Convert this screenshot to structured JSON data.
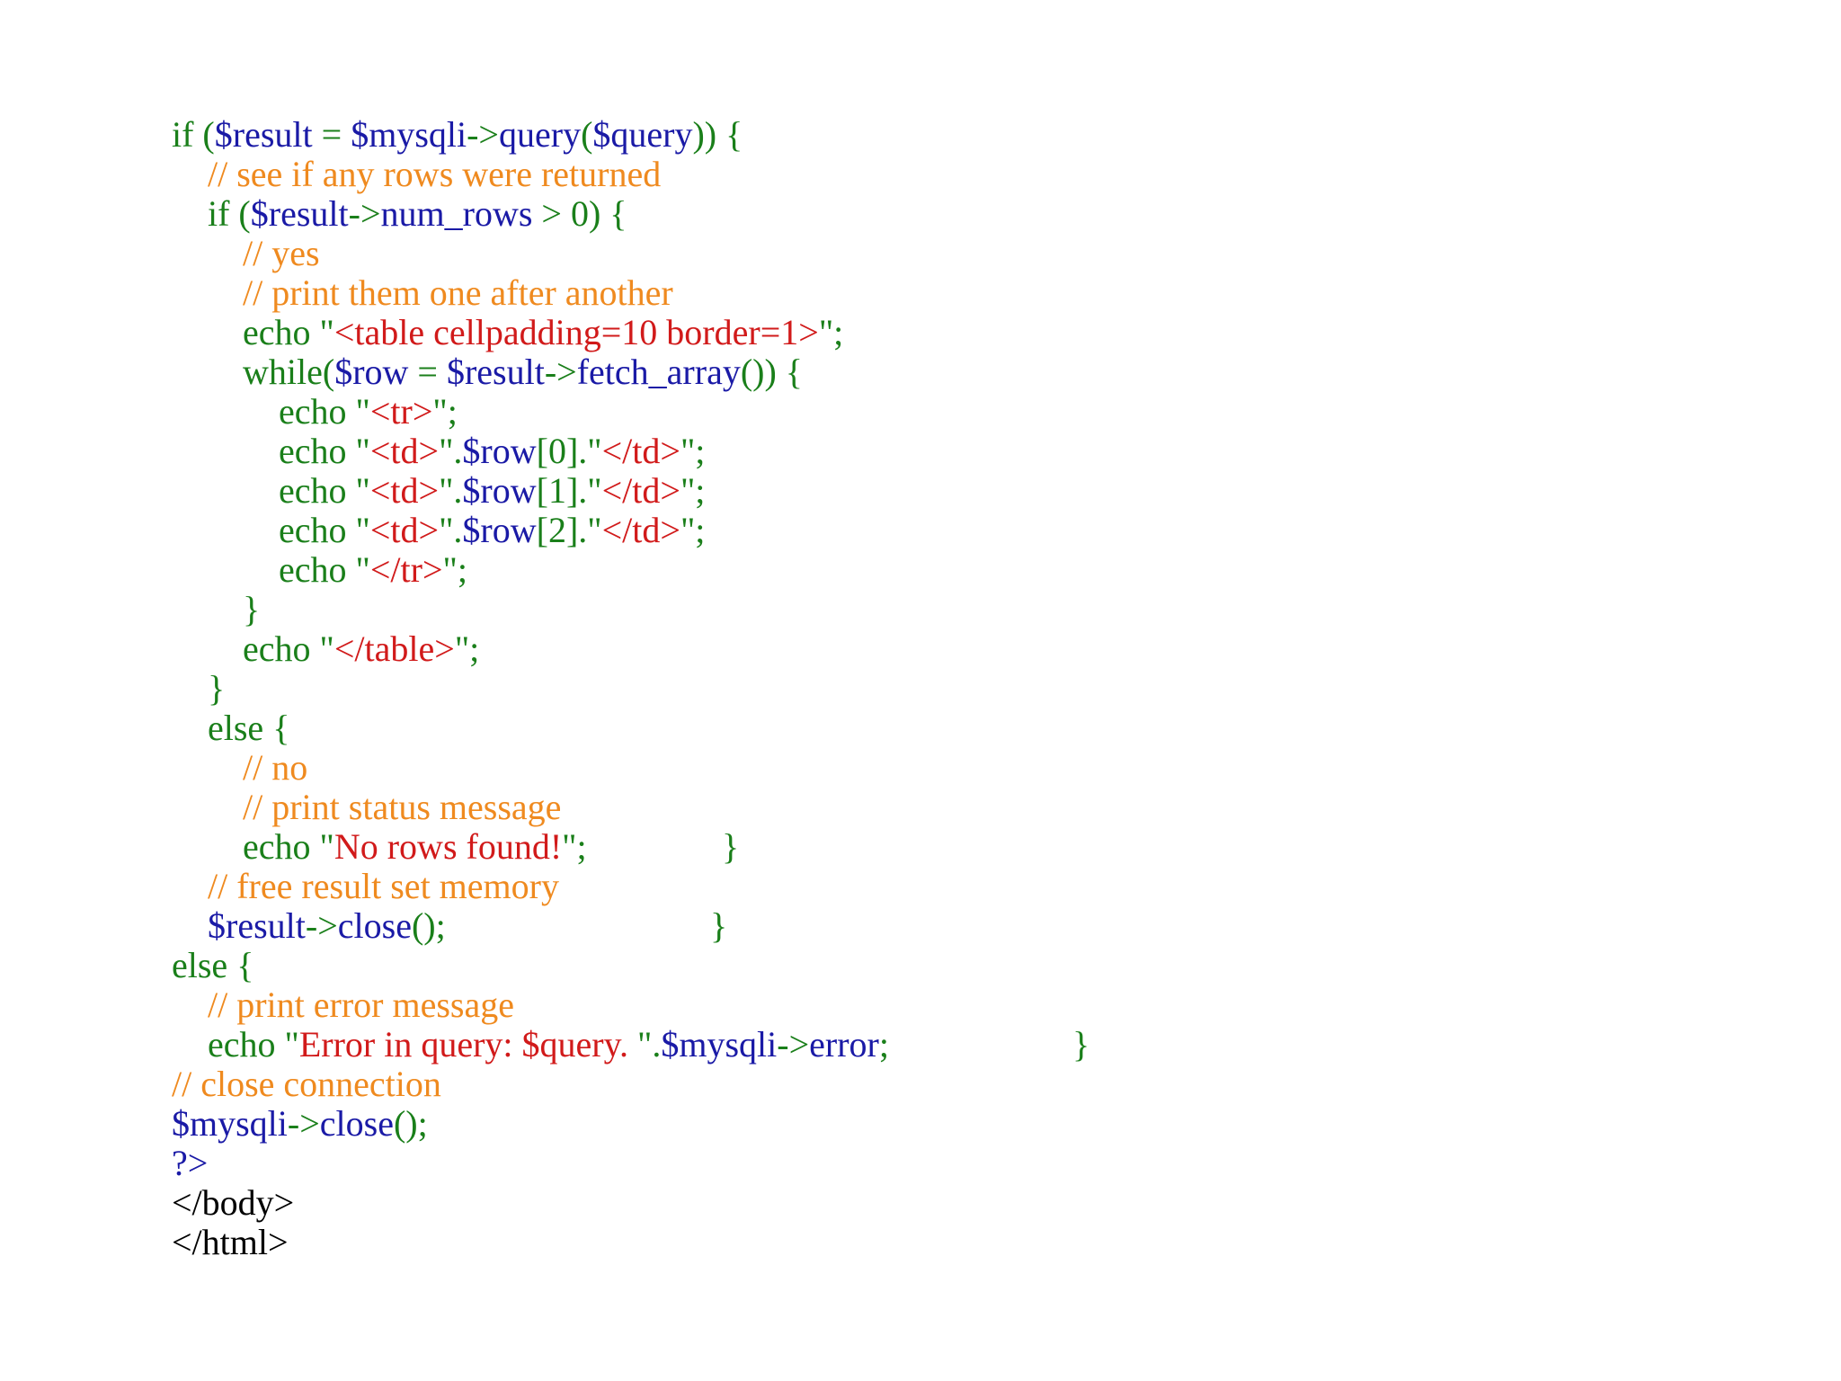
{
  "colors": {
    "keyword": "#1a7f1a",
    "variable": "#1a1aa6",
    "string": "#d11a1a",
    "comment": "#ef8a1f",
    "plain": "#000000"
  },
  "lines": [
    {
      "indent": 0,
      "tokens": [
        {
          "t": "if (",
          "c": "keyword"
        },
        {
          "t": "$result",
          "c": "variable"
        },
        {
          "t": " = ",
          "c": "keyword"
        },
        {
          "t": "$mysqli",
          "c": "variable"
        },
        {
          "t": "->",
          "c": "keyword"
        },
        {
          "t": "query",
          "c": "variable"
        },
        {
          "t": "(",
          "c": "keyword"
        },
        {
          "t": "$query",
          "c": "variable"
        },
        {
          "t": ")) {",
          "c": "keyword"
        }
      ]
    },
    {
      "indent": 1,
      "tokens": [
        {
          "t": "// see if any rows were returned",
          "c": "comment"
        }
      ]
    },
    {
      "indent": 1,
      "tokens": [
        {
          "t": "if (",
          "c": "keyword"
        },
        {
          "t": "$result",
          "c": "variable"
        },
        {
          "t": "->",
          "c": "keyword"
        },
        {
          "t": "num_rows",
          "c": "variable"
        },
        {
          "t": " > 0) {",
          "c": "keyword"
        }
      ]
    },
    {
      "indent": 2,
      "tokens": [
        {
          "t": "// yes",
          "c": "comment"
        }
      ]
    },
    {
      "indent": 2,
      "tokens": [
        {
          "t": "// print them one after another",
          "c": "comment"
        }
      ]
    },
    {
      "indent": 2,
      "tokens": [
        {
          "t": "echo \"",
          "c": "keyword"
        },
        {
          "t": "<table cellpadding=10 border=1>",
          "c": "string"
        },
        {
          "t": "\";",
          "c": "keyword"
        }
      ]
    },
    {
      "indent": 2,
      "tokens": [
        {
          "t": "while(",
          "c": "keyword"
        },
        {
          "t": "$row",
          "c": "variable"
        },
        {
          "t": " = ",
          "c": "keyword"
        },
        {
          "t": "$result",
          "c": "variable"
        },
        {
          "t": "->",
          "c": "keyword"
        },
        {
          "t": "fetch_array",
          "c": "variable"
        },
        {
          "t": "()) {",
          "c": "keyword"
        }
      ]
    },
    {
      "indent": 3,
      "tokens": [
        {
          "t": "echo \"",
          "c": "keyword"
        },
        {
          "t": "<tr>",
          "c": "string"
        },
        {
          "t": "\";",
          "c": "keyword"
        }
      ]
    },
    {
      "indent": 3,
      "tokens": [
        {
          "t": "echo \"",
          "c": "keyword"
        },
        {
          "t": "<td>",
          "c": "string"
        },
        {
          "t": "\".",
          "c": "keyword"
        },
        {
          "t": "$row",
          "c": "variable"
        },
        {
          "t": "[0].\"",
          "c": "keyword"
        },
        {
          "t": "</td>",
          "c": "string"
        },
        {
          "t": "\";",
          "c": "keyword"
        }
      ]
    },
    {
      "indent": 3,
      "tokens": [
        {
          "t": "echo \"",
          "c": "keyword"
        },
        {
          "t": "<td>",
          "c": "string"
        },
        {
          "t": "\".",
          "c": "keyword"
        },
        {
          "t": "$row",
          "c": "variable"
        },
        {
          "t": "[1].\"",
          "c": "keyword"
        },
        {
          "t": "</td>",
          "c": "string"
        },
        {
          "t": "\";",
          "c": "keyword"
        }
      ]
    },
    {
      "indent": 3,
      "tokens": [
        {
          "t": "echo \"",
          "c": "keyword"
        },
        {
          "t": "<td>",
          "c": "string"
        },
        {
          "t": "\".",
          "c": "keyword"
        },
        {
          "t": "$row",
          "c": "variable"
        },
        {
          "t": "[2].\"",
          "c": "keyword"
        },
        {
          "t": "</td>",
          "c": "string"
        },
        {
          "t": "\";",
          "c": "keyword"
        }
      ]
    },
    {
      "indent": 3,
      "tokens": [
        {
          "t": "echo \"",
          "c": "keyword"
        },
        {
          "t": "</tr>",
          "c": "string"
        },
        {
          "t": "\";",
          "c": "keyword"
        }
      ]
    },
    {
      "indent": 2,
      "tokens": [
        {
          "t": "}",
          "c": "keyword"
        }
      ]
    },
    {
      "indent": 2,
      "tokens": [
        {
          "t": "echo \"",
          "c": "keyword"
        },
        {
          "t": "</table>",
          "c": "string"
        },
        {
          "t": "\";",
          "c": "keyword"
        }
      ]
    },
    {
      "indent": 1,
      "tokens": [
        {
          "t": "}",
          "c": "keyword"
        }
      ]
    },
    {
      "indent": 1,
      "tokens": [
        {
          "t": "else {",
          "c": "keyword"
        }
      ]
    },
    {
      "indent": 2,
      "tokens": [
        {
          "t": "// no",
          "c": "comment"
        }
      ]
    },
    {
      "indent": 2,
      "tokens": [
        {
          "t": "// print status message",
          "c": "comment"
        }
      ]
    },
    {
      "indent": 2,
      "tokens": [
        {
          "t": "echo \"",
          "c": "keyword"
        },
        {
          "t": "No rows found!",
          "c": "string"
        },
        {
          "t": "\";",
          "c": "keyword"
        }
      ],
      "trail": {
        "t": "}",
        "c": "keyword",
        "col": 625
      }
    },
    {
      "indent": 1,
      "tokens": [
        {
          "t": "// free result set memory",
          "c": "comment"
        }
      ]
    },
    {
      "indent": 1,
      "tokens": [
        {
          "t": "$result",
          "c": "variable"
        },
        {
          "t": "->",
          "c": "keyword"
        },
        {
          "t": "close",
          "c": "variable"
        },
        {
          "t": "();",
          "c": "keyword"
        }
      ],
      "trail": {
        "t": "}",
        "c": "keyword",
        "col": 615
      }
    },
    {
      "indent": 0,
      "tokens": [
        {
          "t": "else {",
          "c": "keyword"
        }
      ]
    },
    {
      "indent": 1,
      "tokens": [
        {
          "t": "// print error message",
          "c": "comment"
        }
      ]
    },
    {
      "indent": 1,
      "tokens": [
        {
          "t": "echo \"",
          "c": "keyword"
        },
        {
          "t": "Error in query: $query. ",
          "c": "string"
        },
        {
          "t": "\".",
          "c": "keyword"
        },
        {
          "t": "$mysqli",
          "c": "variable"
        },
        {
          "t": "->",
          "c": "keyword"
        },
        {
          "t": "error",
          "c": "variable"
        },
        {
          "t": ";",
          "c": "keyword"
        }
      ],
      "trail": {
        "t": "}",
        "c": "keyword",
        "col": 930
      }
    },
    {
      "indent": 0,
      "tokens": [
        {
          "t": "// close connection",
          "c": "comment"
        }
      ]
    },
    {
      "indent": 0,
      "tokens": [
        {
          "t": "$mysqli",
          "c": "variable"
        },
        {
          "t": "->",
          "c": "keyword"
        },
        {
          "t": "close",
          "c": "variable"
        },
        {
          "t": "();",
          "c": "keyword"
        }
      ]
    },
    {
      "indent": 0,
      "tokens": [
        {
          "t": "?>",
          "c": "variable"
        }
      ]
    },
    {
      "indent": 0,
      "tokens": [
        {
          "t": "</body>",
          "c": "plain"
        }
      ]
    },
    {
      "indent": 0,
      "tokens": [
        {
          "t": "</html>",
          "c": "plain"
        }
      ]
    }
  ]
}
